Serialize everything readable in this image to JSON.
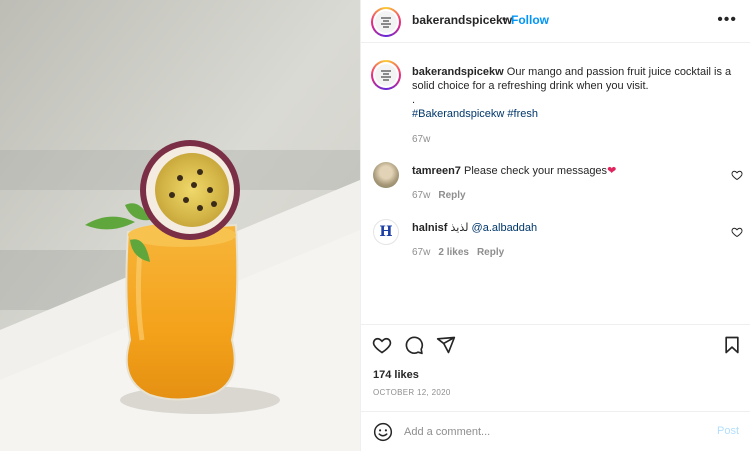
{
  "header": {
    "username": "bakerandspicekw",
    "separator": "•",
    "follow_label": "Follow",
    "more_icon": "more-horizontal-icon"
  },
  "caption": {
    "username": "bakerandspicekw",
    "text": "Our mango and passion fruit juice cocktail is a solid choice for a refreshing drink when you visit.",
    "dot": ".",
    "hashtag1": "#Bakerandspicekw",
    "hashtag2": "#fresh",
    "time": "67w"
  },
  "comments": [
    {
      "username": "tamreen7",
      "text": "Please check your messages",
      "time": "67w",
      "reply": "Reply"
    },
    {
      "username": "halnisf",
      "text_arabic": "لذيذ",
      "mention": "@a.albaddah",
      "time": "67w",
      "likes": "2 likes",
      "reply": "Reply",
      "avatar_letter": "H"
    }
  ],
  "actions": {
    "likes": "174 likes",
    "date": "OCTOBER 12, 2020"
  },
  "add_comment": {
    "placeholder": "Add a comment...",
    "post_label": "Post"
  },
  "colors": {
    "accent": "#0095f6",
    "hashtag": "#00376b",
    "muted": "#8e8e8e",
    "post_disabled": "#b2dffc",
    "juice": "#f5a623"
  }
}
